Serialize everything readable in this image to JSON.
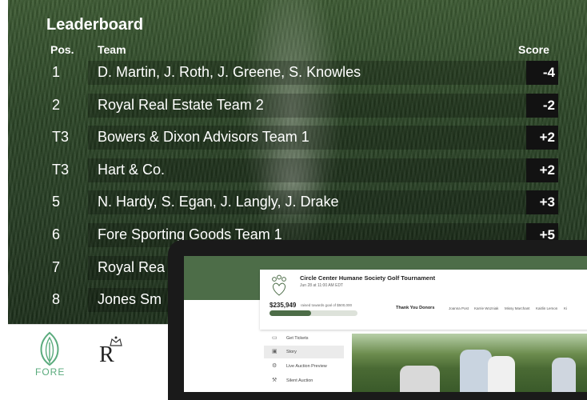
{
  "leaderboard": {
    "title": "Leaderboard",
    "headers": {
      "pos": "Pos.",
      "team": "Team",
      "score": "Score"
    },
    "rows": [
      {
        "pos": "1",
        "team": "D. Martin, J. Roth, J. Greene, S. Knowles",
        "score": "-4"
      },
      {
        "pos": "2",
        "team": "Royal Real Estate Team 2",
        "score": "-2"
      },
      {
        "pos": "T3",
        "team": "Bowers & Dixon Advisors Team 1",
        "score": "+2"
      },
      {
        "pos": "T3",
        "team": "Hart & Co.",
        "score": "+2"
      },
      {
        "pos": "5",
        "team": "N. Hardy, S. Egan, J. Langly, J. Drake",
        "score": "+3"
      },
      {
        "pos": "6",
        "team": "Fore Sporting Goods Team 1",
        "score": "+5"
      },
      {
        "pos": "7",
        "team": "Royal Rea",
        "score": ""
      },
      {
        "pos": "8",
        "team": "Jones Sm",
        "score": ""
      }
    ]
  },
  "sponsors": {
    "fore_logo_text": "FORE",
    "r_logo_letter": "R"
  },
  "screen": {
    "event_title": "Circle Center Humane Society Golf Tournament",
    "event_date": "Jun 28 at 11:00 AM EDT",
    "raised": "$235,949",
    "goal_text": "raised towards goal of $500,000",
    "progress": 0.47,
    "thank_you": "Thank You Donors",
    "donors": [
      "Joanna Post",
      "Karrie Wozniak",
      "Missy Marchant",
      "Kaitlin Lemon",
      "Ki"
    ],
    "sidebar": [
      {
        "label": "Get Tickets",
        "icon": "ticket-icon"
      },
      {
        "label": "Story",
        "icon": "story-icon"
      },
      {
        "label": "Live Auction Preview",
        "icon": "auction-icon"
      },
      {
        "label": "Silent Auction",
        "icon": "gavel-icon"
      }
    ]
  }
}
